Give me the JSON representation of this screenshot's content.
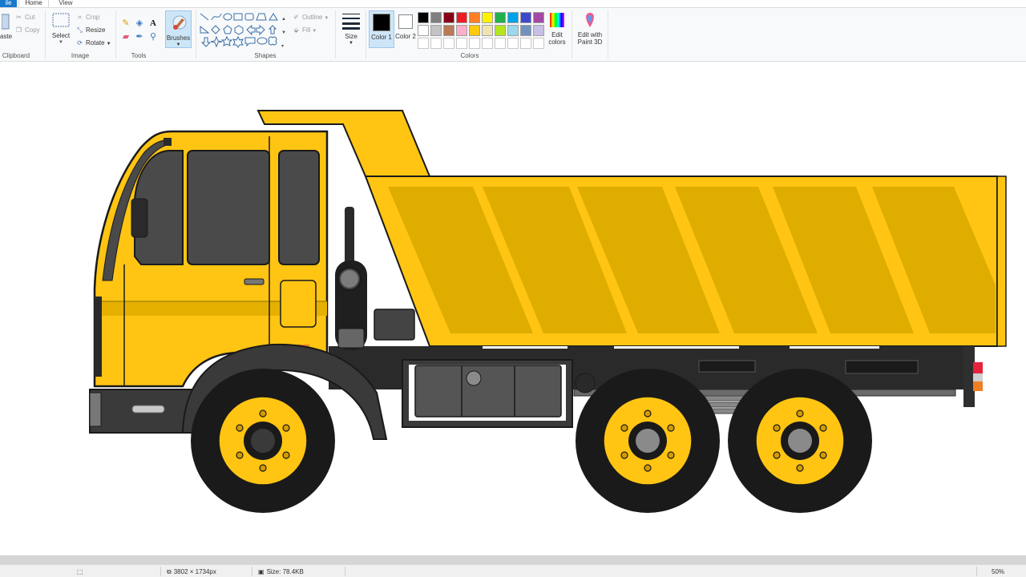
{
  "tabs": {
    "file": "ile",
    "home": "Home",
    "view": "View"
  },
  "clipboard": {
    "paste": "aste",
    "cut": "Cut",
    "copy": "Copy",
    "label": "Clipboard"
  },
  "image": {
    "select": "Select",
    "crop": "Crop",
    "resize": "Resize",
    "rotate": "Rotate",
    "label": "Image"
  },
  "tools": {
    "label": "Tools",
    "text_glyph": "A"
  },
  "brushes": {
    "label": "Brushes"
  },
  "shapes": {
    "outline": "Outline",
    "fill": "Fill",
    "label": "Shapes"
  },
  "size": {
    "label": "Size"
  },
  "colors": {
    "color1_label": "Color 1",
    "color2_label": "Color 2",
    "color1_num": "1",
    "color2_num": "2",
    "edit_colors": "Edit colors",
    "edit_paint3d": "Edit with Paint 3D",
    "label": "Colors",
    "color1_value": "#000000",
    "color2_value": "#ffffff",
    "row1": [
      "#000000",
      "#7f7f7f",
      "#880015",
      "#ed1c24",
      "#ff7f27",
      "#fff200",
      "#22b14c",
      "#00a2e8",
      "#3f48cc",
      "#a349a4"
    ],
    "row2": [
      "#ffffff",
      "#c3c3c3",
      "#b97a57",
      "#ffaec9",
      "#ffc90e",
      "#efe4b0",
      "#b5e61d",
      "#99d9ea",
      "#7092be",
      "#c8bfe7"
    ]
  },
  "status": {
    "dimensions": "3802 × 1734px",
    "size": "Size: 78.4KB",
    "zoom": "50%"
  }
}
